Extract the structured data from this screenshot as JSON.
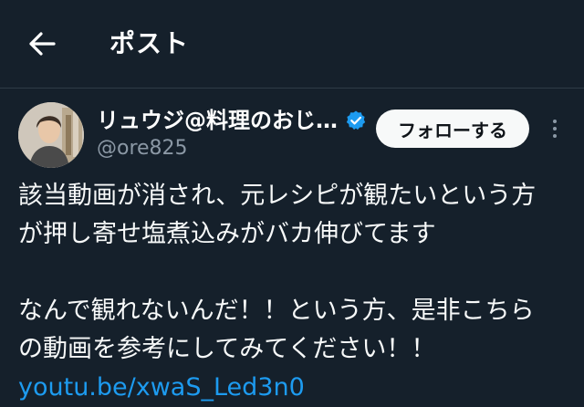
{
  "header": {
    "title": "ポスト",
    "back_icon": "arrow-left-icon"
  },
  "author": {
    "display_name": "リュウジ@料理のおじ…",
    "handle": "@ore825",
    "verified_icon": "verified-badge-icon",
    "verified_color": "#1d9bf0"
  },
  "actions": {
    "follow_label": "フォローする",
    "more_icon": "more-vertical-icon"
  },
  "post": {
    "lines": [
      "該当動画が消され、元レシピが観たいという方",
      "が押し寄せ塩煮込みがバカ伸びてます",
      "",
      "なんで観れないんだ！！という方、是非こちら",
      "の動画を参考にしてみてください！！"
    ],
    "link": "youtu.be/xwaS_Led3n0"
  },
  "colors": {
    "background": "#15202b",
    "link": "#1d9bf0",
    "secondary_text": "#8b98a5",
    "follow_button_bg": "#f7f9f9"
  }
}
